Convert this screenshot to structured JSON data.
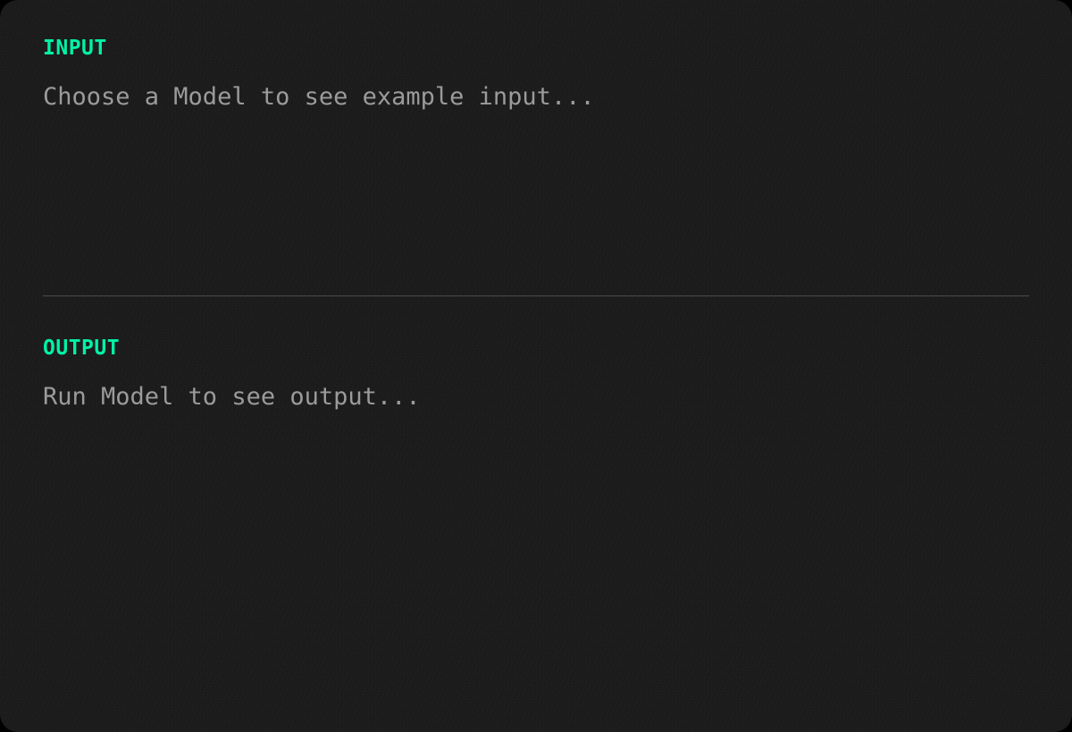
{
  "panel": {
    "background_color": "#1c1c1c",
    "outer_color": "#000000",
    "corner_radius": "20px"
  },
  "colors": {
    "accent_green": "#00f2a6",
    "body_text": "#9b9b9b",
    "divider": "#4b4b4b"
  },
  "input_section": {
    "label": "INPUT",
    "placeholder_text": "Choose a Model to see example input..."
  },
  "output_section": {
    "label": "OUTPUT",
    "placeholder_text": "Run Model to see output..."
  }
}
